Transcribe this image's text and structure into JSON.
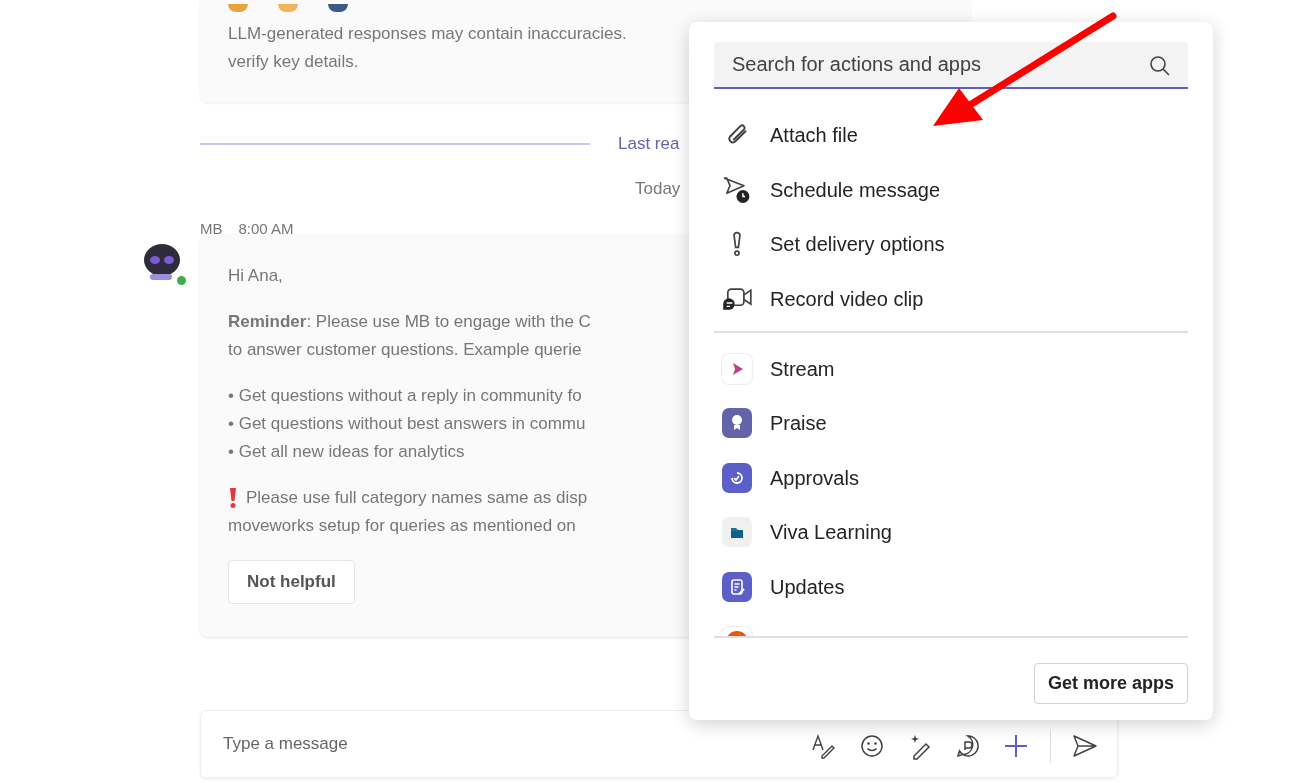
{
  "background": {
    "top_card": {
      "lines": [
        "LLM-generated responses may contain inaccuracies.",
        "verify key details."
      ]
    },
    "divider_label": "Last rea",
    "date_label": "Today",
    "message": {
      "sender": "MB",
      "time": "8:00 AM",
      "online": true,
      "greeting": "Hi Ana,",
      "paragraph_lines": [
        "**Reminder**: Please use MB to engage with the C",
        "to answer customer questions. Example querie"
      ],
      "bullets": [
        "• Get questions without a reply in community fo",
        "• Get questions without best answers in commu",
        "• Get all new ideas for analytics"
      ],
      "note_lines": [
        "Please use full category names same as disp",
        "moveworks setup for queries as mentioned on"
      ],
      "feedback_button": "Not helpful"
    }
  },
  "compose": {
    "placeholder": "Type a message"
  },
  "menu": {
    "search": {
      "placeholder": "Search for actions and apps"
    },
    "actions": [
      {
        "label": "Attach file",
        "kind": "attach"
      },
      {
        "label": "Schedule message",
        "kind": "schedule"
      },
      {
        "label": "Set delivery options",
        "kind": "delivery"
      },
      {
        "label": "Record video clip",
        "kind": "video"
      }
    ],
    "apps": [
      {
        "label": "Stream",
        "kind": "stream"
      },
      {
        "label": "Praise",
        "kind": "praise"
      },
      {
        "label": "Approvals",
        "kind": "approvals"
      },
      {
        "label": "Viva Learning",
        "kind": "learning"
      },
      {
        "label": "Updates",
        "kind": "updates"
      },
      {
        "kind": "orange"
      }
    ],
    "footer_button": "Get more apps"
  }
}
